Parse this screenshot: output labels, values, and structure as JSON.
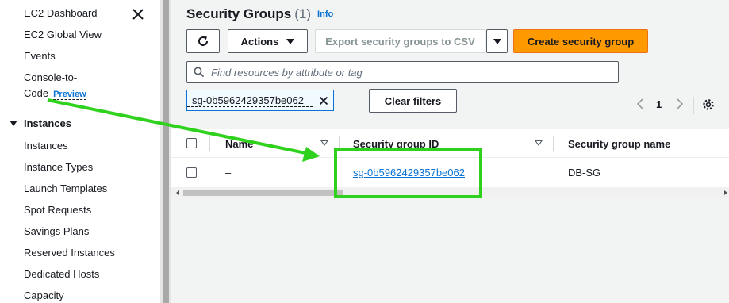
{
  "sidebar": {
    "items_top": [
      {
        "label": "EC2 Dashboard"
      },
      {
        "label": "EC2 Global View"
      },
      {
        "label": "Events"
      }
    ],
    "console_to_code": {
      "line1": "Console-to-",
      "line2": "Code",
      "badge": "Preview"
    },
    "section": "Instances",
    "instances_items": [
      {
        "label": "Instances"
      },
      {
        "label": "Instance Types"
      },
      {
        "label": "Launch Templates"
      },
      {
        "label": "Spot Requests"
      },
      {
        "label": "Savings Plans"
      },
      {
        "label": "Reserved Instances"
      },
      {
        "label": "Dedicated Hosts"
      },
      {
        "label": "Capacity"
      }
    ]
  },
  "header": {
    "title": "Security Groups",
    "count": "(1)",
    "info": "Info"
  },
  "toolbar": {
    "actions_label": "Actions",
    "export_label": "Export security groups to CSV",
    "create_label": "Create security group"
  },
  "search": {
    "placeholder": "Find resources by attribute or tag"
  },
  "filter": {
    "token": "sg-0b5962429357be062",
    "clear_label": "Clear filters"
  },
  "pagination": {
    "current_page": "1"
  },
  "table": {
    "columns": [
      "Name",
      "Security group ID",
      "Security group name"
    ],
    "rows": [
      {
        "name": "–",
        "group_id": "sg-0b5962429357be062",
        "group_name": "DB-SG"
      }
    ]
  },
  "colors": {
    "accent": "#0972d3",
    "primary_button": "#ff9900",
    "annotation": "#2ed11b"
  }
}
